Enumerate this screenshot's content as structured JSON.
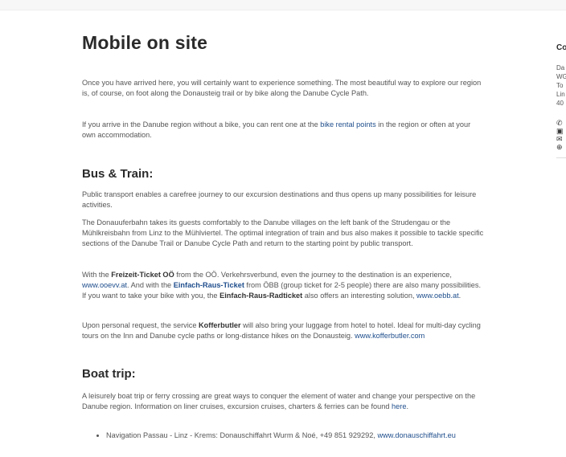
{
  "page": {
    "title": "Mobile on site",
    "intro": [
      "Once you have arrived here, you will certainly want to experience something. The most beautiful way to explore our region is, of course, on foot along the Donausteig trail or by bike along the Danube Cycle Path.",
      {
        "before": "If you arrive in the Danube region without a bike, you can rent one at the ",
        "link": "bike rental points",
        "after": " in the region or often at your own accommodation."
      }
    ]
  },
  "bus_train": {
    "heading": "Bus & Train:",
    "p1": "Public transport enables a carefree journey to our excursion destinations and thus opens up many possibilities for leisure activities.",
    "p2": "The Donauuferbahn takes its guests comfortably to the Danube villages on the left bank of the Strudengau or the Mühlkreisbahn from Linz to the Mühlviertel. The optimal integration of train and bus also makes it possible to tackle specific sections of the Danube Trail or Danube Cycle Path and return to the starting point by public transport.",
    "p3": {
      "a": "With the ",
      "b_bold": "Freizeit-Ticket OÖ",
      "c": " from the OÖ. Verkehrsverbund, even the journey to the destination is an experience, ",
      "d_link": "www.ooevv.at",
      "e": ". And with the ",
      "f_link_bold": "Einfach-Raus-Ticket",
      "g": " from ÖBB (group ticket for 2-5 people) there are also many possibilities. If you want to take your bike with you, the ",
      "h_bold": "Einfach-Raus-Radticket",
      "i": " also offers an interesting solution, ",
      "j_link": "www.oebb.at",
      "k": "."
    },
    "p4": {
      "a": "Upon personal request, the service ",
      "b_bold": "Kofferbutler",
      "c": " will also bring your luggage from hotel to hotel. Ideal for multi-day cycling tours on the Inn and Danube cycle paths or long-distance hikes on the Donausteig. ",
      "d_link": "www.kofferbutler.com"
    }
  },
  "boat": {
    "heading": "Boat trip:",
    "p1": {
      "a": "A leisurely boat trip or ferry crossing are great ways to conquer the element of water and change your perspective on the Danube region. Information on liner cruises, excursion cruises, charters & ferries can be found ",
      "b_link": "here",
      "c": "."
    },
    "list": [
      {
        "text": "Navigation Passau - Linz - Krems: Donauschiffahrt Wurm & Noé, +49 851 929292, ",
        "link": "www.donauschiffahrt.eu"
      }
    ]
  },
  "sidebar": {
    "title": "Co",
    "lines": [
      "Da",
      "WG",
      "To",
      "Lin",
      "40"
    ],
    "icons": [
      "phone-icon",
      "fax-icon",
      "email-icon",
      "globe-icon"
    ],
    "icon_glyphs": [
      "✆",
      "▣",
      "✉",
      "⊕"
    ]
  }
}
